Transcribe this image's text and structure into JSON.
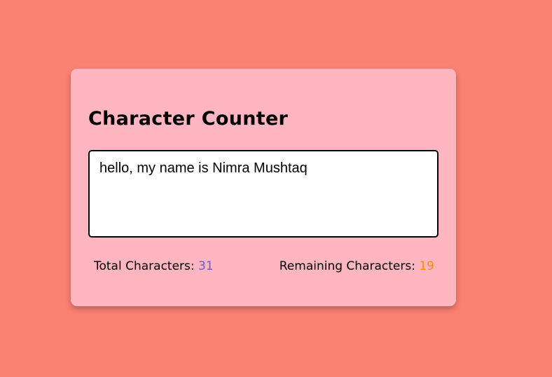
{
  "app": {
    "title": "Character Counter"
  },
  "input": {
    "value": "hello, my name is Nimra Mushtaq",
    "placeholder": ""
  },
  "stats": {
    "total_label": "Total Characters:",
    "total_value": "31",
    "remaining_label": "Remaining Characters:",
    "remaining_value": "19"
  },
  "colors": {
    "background": "#fa8072",
    "card": "#ffb6c1",
    "total_value": "#6a5acd",
    "remaining_value": "#ff8c00"
  }
}
